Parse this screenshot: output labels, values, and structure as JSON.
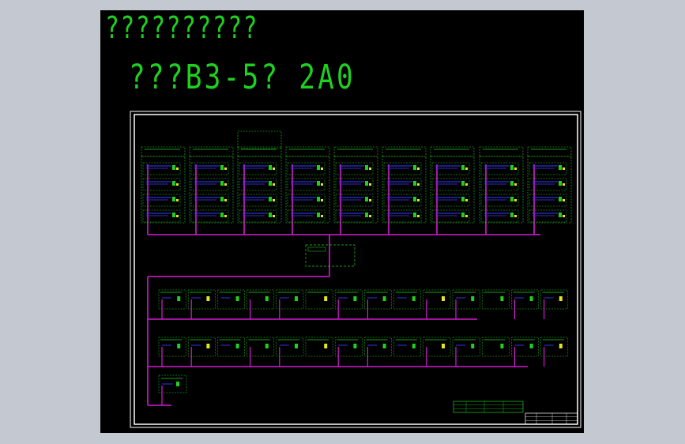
{
  "drawing": {
    "title": "??????????",
    "subtitle": "???B3-5? 2A0"
  },
  "colors": {
    "window_background": "#c4c9d1",
    "sheet_background": "#000000",
    "frame": "#ffffff",
    "cad_text": "#1fd11f",
    "trunk_line": "#d41ad4",
    "panel_outline": "#1fd11f",
    "wire_blue": "#3a3aff",
    "device_yellow": "#e6e61e"
  },
  "layout_summary": {
    "top_panel_groups": 9,
    "middle_rows": 2,
    "bottom_small_groups": 1
  }
}
